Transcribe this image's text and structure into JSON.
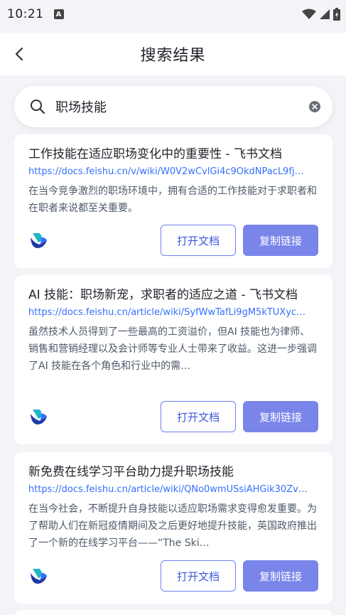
{
  "status_bar": {
    "time": "10:21",
    "notif_letter": "A"
  },
  "header": {
    "title": "搜索结果"
  },
  "search": {
    "value": "职场技能"
  },
  "results": [
    {
      "title": "工作技能在适应职场变化中的重要性 - 飞书文档",
      "url": "https://docs.feishu.cn/v/wiki/W0V2wCvlGi4c9OkdNPacL9fj…",
      "desc": "在当今竞争激烈的职场环境中，拥有合适的工作技能对于求职者和在职者来说都至关重要。",
      "open_label": "打开文档",
      "copy_label": "复制链接"
    },
    {
      "title": "AI 技能：职场新宠，求职者的适应之道 - 飞书文档",
      "url": "https://docs.feishu.cn/article/wiki/SyfWwTafLi9gM5kTUXyc…",
      "desc": "虽然技术人员得到了一些最高的工资溢价，但AI 技能也为律师、销售和营销经理以及会计师等专业人士带来了收益。这进一步强调了AI 技能在各个角色和行业中的需…",
      "open_label": "打开文档",
      "copy_label": "复制链接"
    },
    {
      "title": "新免费在线学习平台助力提升职场技能",
      "url": "https://docs.feishu.cn/article/wiki/QNo0wmUSsiAHGik30Zv…",
      "desc": "在当今社会，不断提升自身技能以适应职场需求变得愈发重要。为了帮助人们在新冠疫情期间及之后更好地提升技能，英国政府推出了一个新的在线学习平台——“The Ski…",
      "open_label": "打开文档",
      "copy_label": "复制链接"
    }
  ]
}
